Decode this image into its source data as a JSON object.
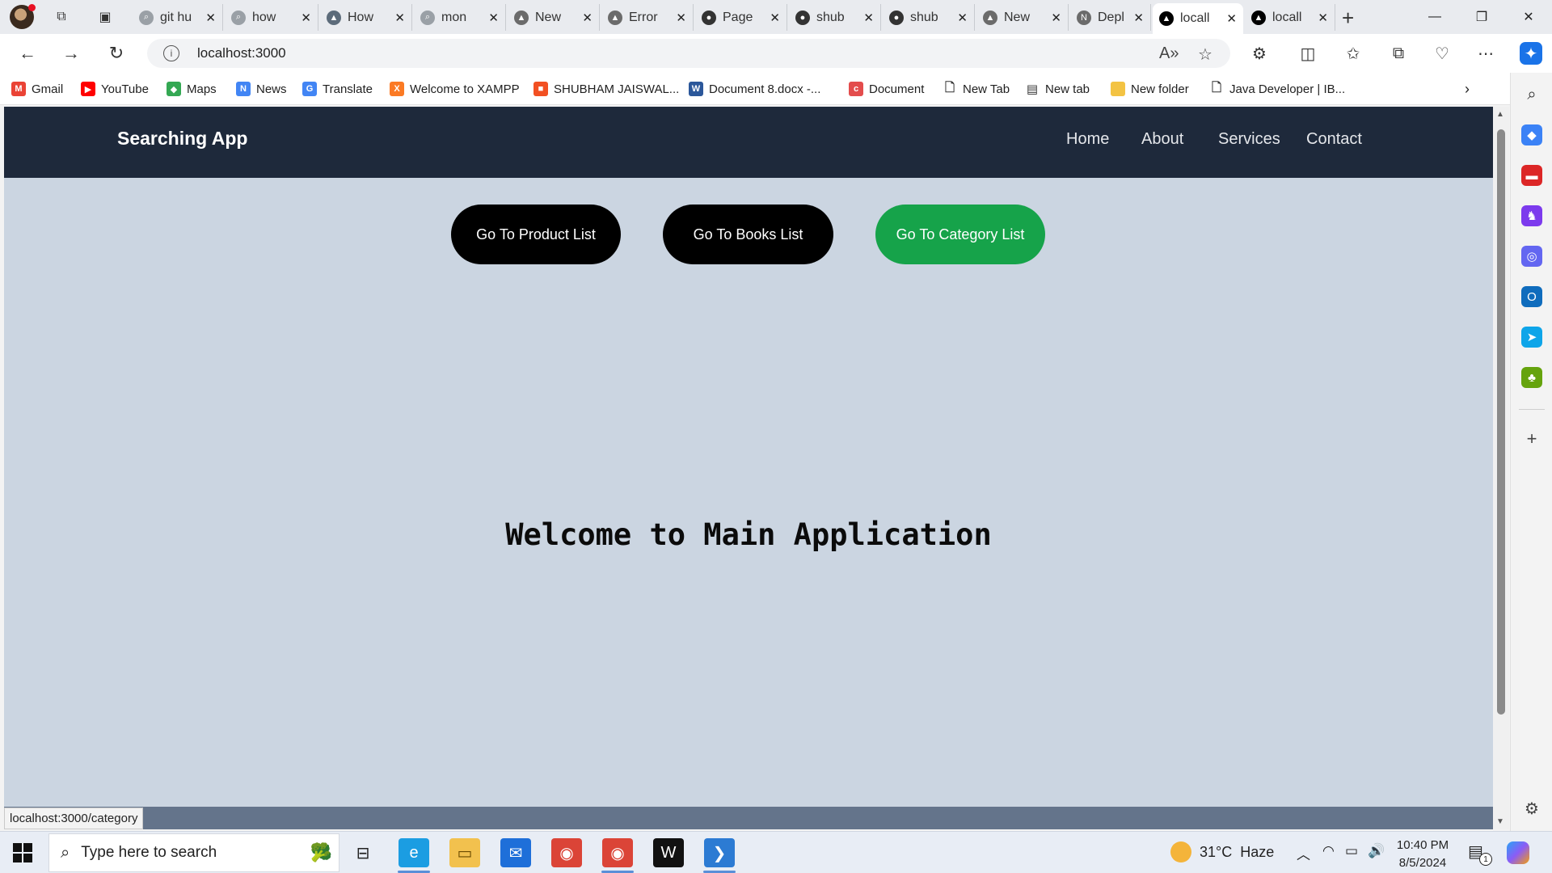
{
  "browser": {
    "tabs": [
      {
        "title": "git hu",
        "icon": "search-icon",
        "fav_color": "#9aa0a6"
      },
      {
        "title": "how",
        "icon": "search-icon",
        "fav_color": "#9aa0a6"
      },
      {
        "title": "How",
        "icon": "app-icon",
        "fav_color": "#5c6b7a"
      },
      {
        "title": "mon",
        "icon": "search-icon",
        "fav_color": "#9aa0a6"
      },
      {
        "title": "New",
        "icon": "vercel-icon",
        "fav_color": "#6b6b6b"
      },
      {
        "title": "Error",
        "icon": "vercel-icon",
        "fav_color": "#6b6b6b"
      },
      {
        "title": "Page",
        "icon": "github-icon",
        "fav_color": "#333333"
      },
      {
        "title": "shub",
        "icon": "github-icon",
        "fav_color": "#333333"
      },
      {
        "title": "shub",
        "icon": "github-icon",
        "fav_color": "#333333"
      },
      {
        "title": "New",
        "icon": "vercel-icon",
        "fav_color": "#6b6b6b"
      },
      {
        "title": "Depl",
        "icon": "netlify-icon",
        "fav_color": "#6b6b6b"
      },
      {
        "title": "locall",
        "icon": "vercel-icon",
        "fav_color": "#000000"
      },
      {
        "title": "locall",
        "icon": "vercel-icon",
        "fav_color": "#000000"
      }
    ],
    "active_tab": 11,
    "url": "localhost:3000",
    "bookmarks": [
      {
        "label": "Gmail",
        "icon": "gmail-icon",
        "color": "#ea4335",
        "glyph": "M"
      },
      {
        "label": "YouTube",
        "icon": "youtube-icon",
        "color": "#ff0000",
        "glyph": "▶"
      },
      {
        "label": "Maps",
        "icon": "maps-icon",
        "color": "#34a853",
        "glyph": "◆"
      },
      {
        "label": "News",
        "icon": "news-icon",
        "color": "#4285f4",
        "glyph": "N"
      },
      {
        "label": "Translate",
        "icon": "translate-icon",
        "color": "#4285f4",
        "glyph": "G"
      },
      {
        "label": "Welcome to XAMPP",
        "icon": "xampp-icon",
        "color": "#fb7a24",
        "glyph": "X"
      },
      {
        "label": "SHUBHAM JAISWAL...",
        "icon": "microsoft-icon",
        "color": "#f25022",
        "glyph": "■"
      },
      {
        "label": "Document 8.docx -...",
        "icon": "word-icon",
        "color": "#2b579a",
        "glyph": "W"
      },
      {
        "label": "Document",
        "icon": "document-icon",
        "color": "#e34c4c",
        "glyph": "c"
      },
      {
        "label": "New Tab",
        "icon": "page-icon",
        "color": "#ffffff",
        "glyph": "🗋"
      },
      {
        "label": "New tab",
        "icon": "tab-icon",
        "color": "#ffffff",
        "glyph": "▤"
      },
      {
        "label": "New folder",
        "icon": "folder-icon",
        "color": "#f3c343",
        "glyph": ""
      },
      {
        "label": "Java Developer | IB...",
        "icon": "page-icon",
        "color": "#ffffff",
        "glyph": "🗋"
      }
    ]
  },
  "app": {
    "brand": "Searching App",
    "nav": [
      "Home",
      "About",
      "Services",
      "Contact"
    ],
    "buttons": [
      {
        "label": "Go To Product List",
        "color": "#000000"
      },
      {
        "label": "Go To Books List",
        "color": "#000000"
      },
      {
        "label": "Go To Category List",
        "color": "#16a34a"
      }
    ],
    "heading": "Welcome to Main Application"
  },
  "status_url": "localhost:3000/category",
  "taskbar": {
    "search_placeholder": "Type here to search",
    "weather": "31°C  Haze",
    "time": "10:40 PM",
    "date": "8/5/2024",
    "notification_count": "1"
  }
}
